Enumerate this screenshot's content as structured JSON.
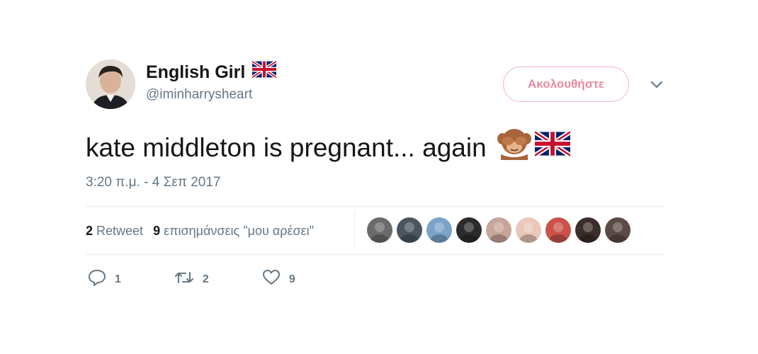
{
  "user": {
    "display_name": "English Girl",
    "handle": "@iminharrysheart",
    "avatar_icon": "profile-photo"
  },
  "follow_button": {
    "label": "Ακολουθήστε"
  },
  "tweet": {
    "text": "kate middleton is pregnant... again",
    "emojis": [
      "see-no-evil-monkey",
      "uk-flag"
    ],
    "timestamp": "3:20 π.μ. - 4 Σεπ 2017"
  },
  "stats": {
    "retweets_count": "2",
    "retweets_label": "Retweet",
    "likes_count": "9",
    "likes_label": "επισημάνσεις \"μου αρέσει\""
  },
  "likers": [
    {
      "color": "#6b6b6b"
    },
    {
      "color": "#4a5560"
    },
    {
      "color": "#7aa3c8"
    },
    {
      "color": "#2b2b2b"
    },
    {
      "color": "#c7a59a"
    },
    {
      "color": "#e9c7b9"
    },
    {
      "color": "#c9534a"
    },
    {
      "color": "#3a2e2a"
    },
    {
      "color": "#5c4a44"
    }
  ],
  "actions": {
    "reply_count": "1",
    "retweet_count": "2",
    "like_count": "9"
  },
  "colors": {
    "text": "#14171a",
    "secondary": "#657786",
    "follow_accent": "#e88aa0",
    "divider": "#e6ecf0"
  }
}
